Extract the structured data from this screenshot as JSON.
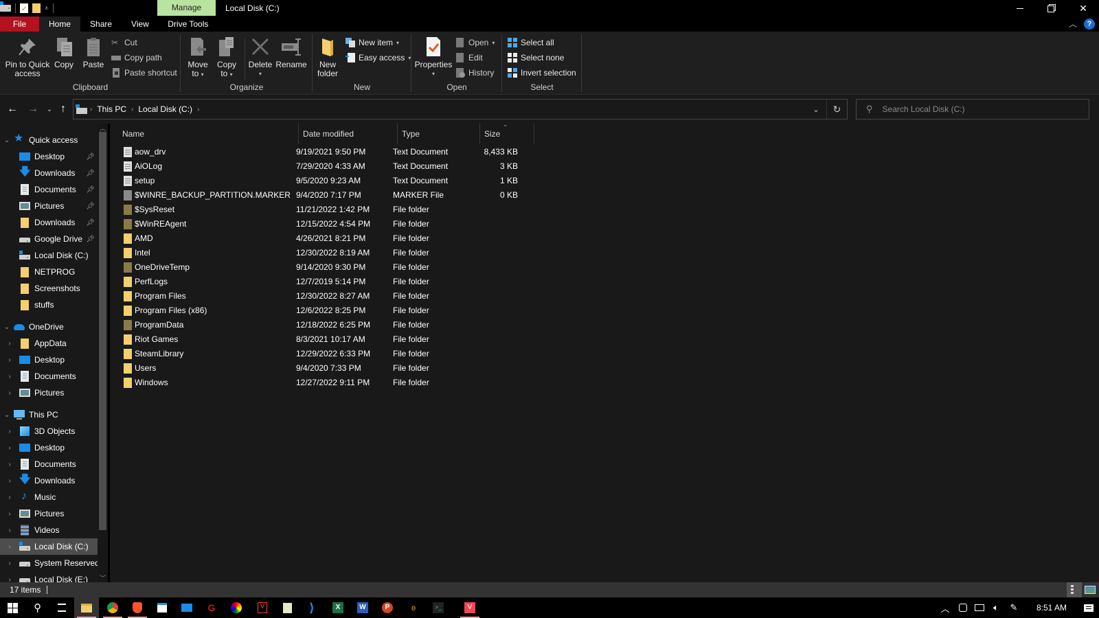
{
  "window": {
    "title": "Local Disk (C:)",
    "context_tab": "Manage",
    "controls": {
      "minimize": "—",
      "restore": "❐",
      "close": "✕"
    }
  },
  "ribbon_tabs": [
    {
      "label": "File"
    },
    {
      "label": "Home"
    },
    {
      "label": "Share"
    },
    {
      "label": "View"
    },
    {
      "label": "Drive Tools"
    }
  ],
  "ribbon": {
    "clipboard": {
      "label": "Clipboard",
      "pin": "Pin to Quick access",
      "pin_l1": "Pin to Quick",
      "pin_l2": "access",
      "copy": "Copy",
      "paste": "Paste",
      "cut": "Cut",
      "copy_path": "Copy path",
      "paste_shortcut": "Paste shortcut"
    },
    "organize": {
      "label": "Organize",
      "move_l1": "Move",
      "move_l2": "to",
      "copy_l1": "Copy",
      "copy_l2": "to",
      "delete": "Delete",
      "rename": "Rename"
    },
    "new": {
      "label": "New",
      "folder_l1": "New",
      "folder_l2": "folder",
      "new_item": "New item",
      "easy_access": "Easy access"
    },
    "open": {
      "label": "Open",
      "properties": "Properties",
      "open": "Open",
      "edit": "Edit",
      "history": "History"
    },
    "select": {
      "label": "Select",
      "select_all": "Select all",
      "select_none": "Select none",
      "invert": "Invert selection"
    }
  },
  "address": {
    "breadcrumb": [
      "This PC",
      "Local Disk (C:)"
    ],
    "search_placeholder": "Search Local Disk (C:)"
  },
  "nav": {
    "quick_access": {
      "label": "Quick access",
      "items": [
        {
          "label": "Desktop",
          "icon": "desktop",
          "pinned": true
        },
        {
          "label": "Downloads",
          "icon": "download",
          "pinned": true
        },
        {
          "label": "Documents",
          "icon": "documents",
          "pinned": true
        },
        {
          "label": "Pictures",
          "icon": "pictures",
          "pinned": true
        },
        {
          "label": "Downloads",
          "icon": "folder",
          "pinned": true
        },
        {
          "label": "Google Drive",
          "icon": "drive",
          "pinned": true
        },
        {
          "label": "Local Disk (C:)",
          "icon": "windrive",
          "pinned": false
        },
        {
          "label": "NETPROG",
          "icon": "folder",
          "pinned": false
        },
        {
          "label": "Screenshots",
          "icon": "folder",
          "pinned": false
        },
        {
          "label": "stuffs",
          "icon": "folder",
          "pinned": false
        }
      ]
    },
    "onedrive": {
      "label": "OneDrive",
      "items": [
        {
          "label": "AppData",
          "icon": "folder"
        },
        {
          "label": "Desktop",
          "icon": "desktop"
        },
        {
          "label": "Documents",
          "icon": "documents"
        },
        {
          "label": "Pictures",
          "icon": "pictures"
        }
      ]
    },
    "this_pc": {
      "label": "This PC",
      "items": [
        {
          "label": "3D Objects",
          "icon": "3d"
        },
        {
          "label": "Desktop",
          "icon": "desktop"
        },
        {
          "label": "Documents",
          "icon": "documents"
        },
        {
          "label": "Downloads",
          "icon": "download"
        },
        {
          "label": "Music",
          "icon": "music"
        },
        {
          "label": "Pictures",
          "icon": "pictures"
        },
        {
          "label": "Videos",
          "icon": "videos"
        },
        {
          "label": "Local Disk (C:)",
          "icon": "windrive",
          "selected": true
        },
        {
          "label": "System Reserved",
          "icon": "drive"
        },
        {
          "label": "Local Disk (E:)",
          "icon": "drive"
        }
      ]
    }
  },
  "columns": {
    "name": "Name",
    "date": "Date modified",
    "type": "Type",
    "size": "Size"
  },
  "files": [
    {
      "name": "aow_drv",
      "date": "9/19/2021 9:50 PM",
      "type": "Text Document",
      "size": "8,433 KB",
      "icon": "text"
    },
    {
      "name": "AiOLog",
      "date": "7/29/2020 4:33 AM",
      "type": "Text Document",
      "size": "3 KB",
      "icon": "text"
    },
    {
      "name": "setup",
      "date": "9/5/2020 9:23 AM",
      "type": "Text Document",
      "size": "1 KB",
      "icon": "text"
    },
    {
      "name": "$WINRE_BACKUP_PARTITION.MARKER",
      "date": "9/4/2020 7:17 PM",
      "type": "MARKER File",
      "size": "0 KB",
      "icon": "blank"
    },
    {
      "name": "$SysReset",
      "date": "11/21/2022 1:42 PM",
      "type": "File folder",
      "size": "",
      "icon": "hidden-folder"
    },
    {
      "name": "$WinREAgent",
      "date": "12/15/2022 4:54 PM",
      "type": "File folder",
      "size": "",
      "icon": "hidden-folder"
    },
    {
      "name": "AMD",
      "date": "4/26/2021 8:21 PM",
      "type": "File folder",
      "size": "",
      "icon": "folder"
    },
    {
      "name": "Intel",
      "date": "12/30/2022 8:19 AM",
      "type": "File folder",
      "size": "",
      "icon": "folder"
    },
    {
      "name": "OneDriveTemp",
      "date": "9/14/2020 9:30 PM",
      "type": "File folder",
      "size": "",
      "icon": "hidden-folder"
    },
    {
      "name": "PerfLogs",
      "date": "12/7/2019 5:14 PM",
      "type": "File folder",
      "size": "",
      "icon": "folder"
    },
    {
      "name": "Program Files",
      "date": "12/30/2022 8:27 AM",
      "type": "File folder",
      "size": "",
      "icon": "folder"
    },
    {
      "name": "Program Files (x86)",
      "date": "12/6/2022 8:25 PM",
      "type": "File folder",
      "size": "",
      "icon": "folder"
    },
    {
      "name": "ProgramData",
      "date": "12/18/2022 6:25 PM",
      "type": "File folder",
      "size": "",
      "icon": "hidden-folder"
    },
    {
      "name": "Riot Games",
      "date": "8/3/2021 10:17 AM",
      "type": "File folder",
      "size": "",
      "icon": "folder"
    },
    {
      "name": "SteamLibrary",
      "date": "12/29/2022 6:33 PM",
      "type": "File folder",
      "size": "",
      "icon": "folder"
    },
    {
      "name": "Users",
      "date": "9/4/2020 7:33 PM",
      "type": "File folder",
      "size": "",
      "icon": "folder"
    },
    {
      "name": "Windows",
      "date": "12/27/2022 9:11 PM",
      "type": "File folder",
      "size": "",
      "icon": "folder"
    }
  ],
  "status": {
    "item_count": "17 items"
  },
  "taskbar": {
    "apps": [
      "start",
      "search",
      "task-view",
      "file-explorer",
      "chrome",
      "brave",
      "microsoft-store",
      "mail",
      "game-app",
      "color-app",
      "valorant-app",
      "notepad-app",
      "vscode",
      "excel",
      "word",
      "powerpoint",
      "misc-app",
      "terminal-app",
      "valorant"
    ],
    "time": "8:51 AM"
  },
  "colors": {
    "file_tab": "#b3121e",
    "manage_tab": "#b8e3a0",
    "folder": "#f4cf6e",
    "hidden_folder": "#8a7a4a",
    "accent_blue": "#1a8ce8"
  }
}
